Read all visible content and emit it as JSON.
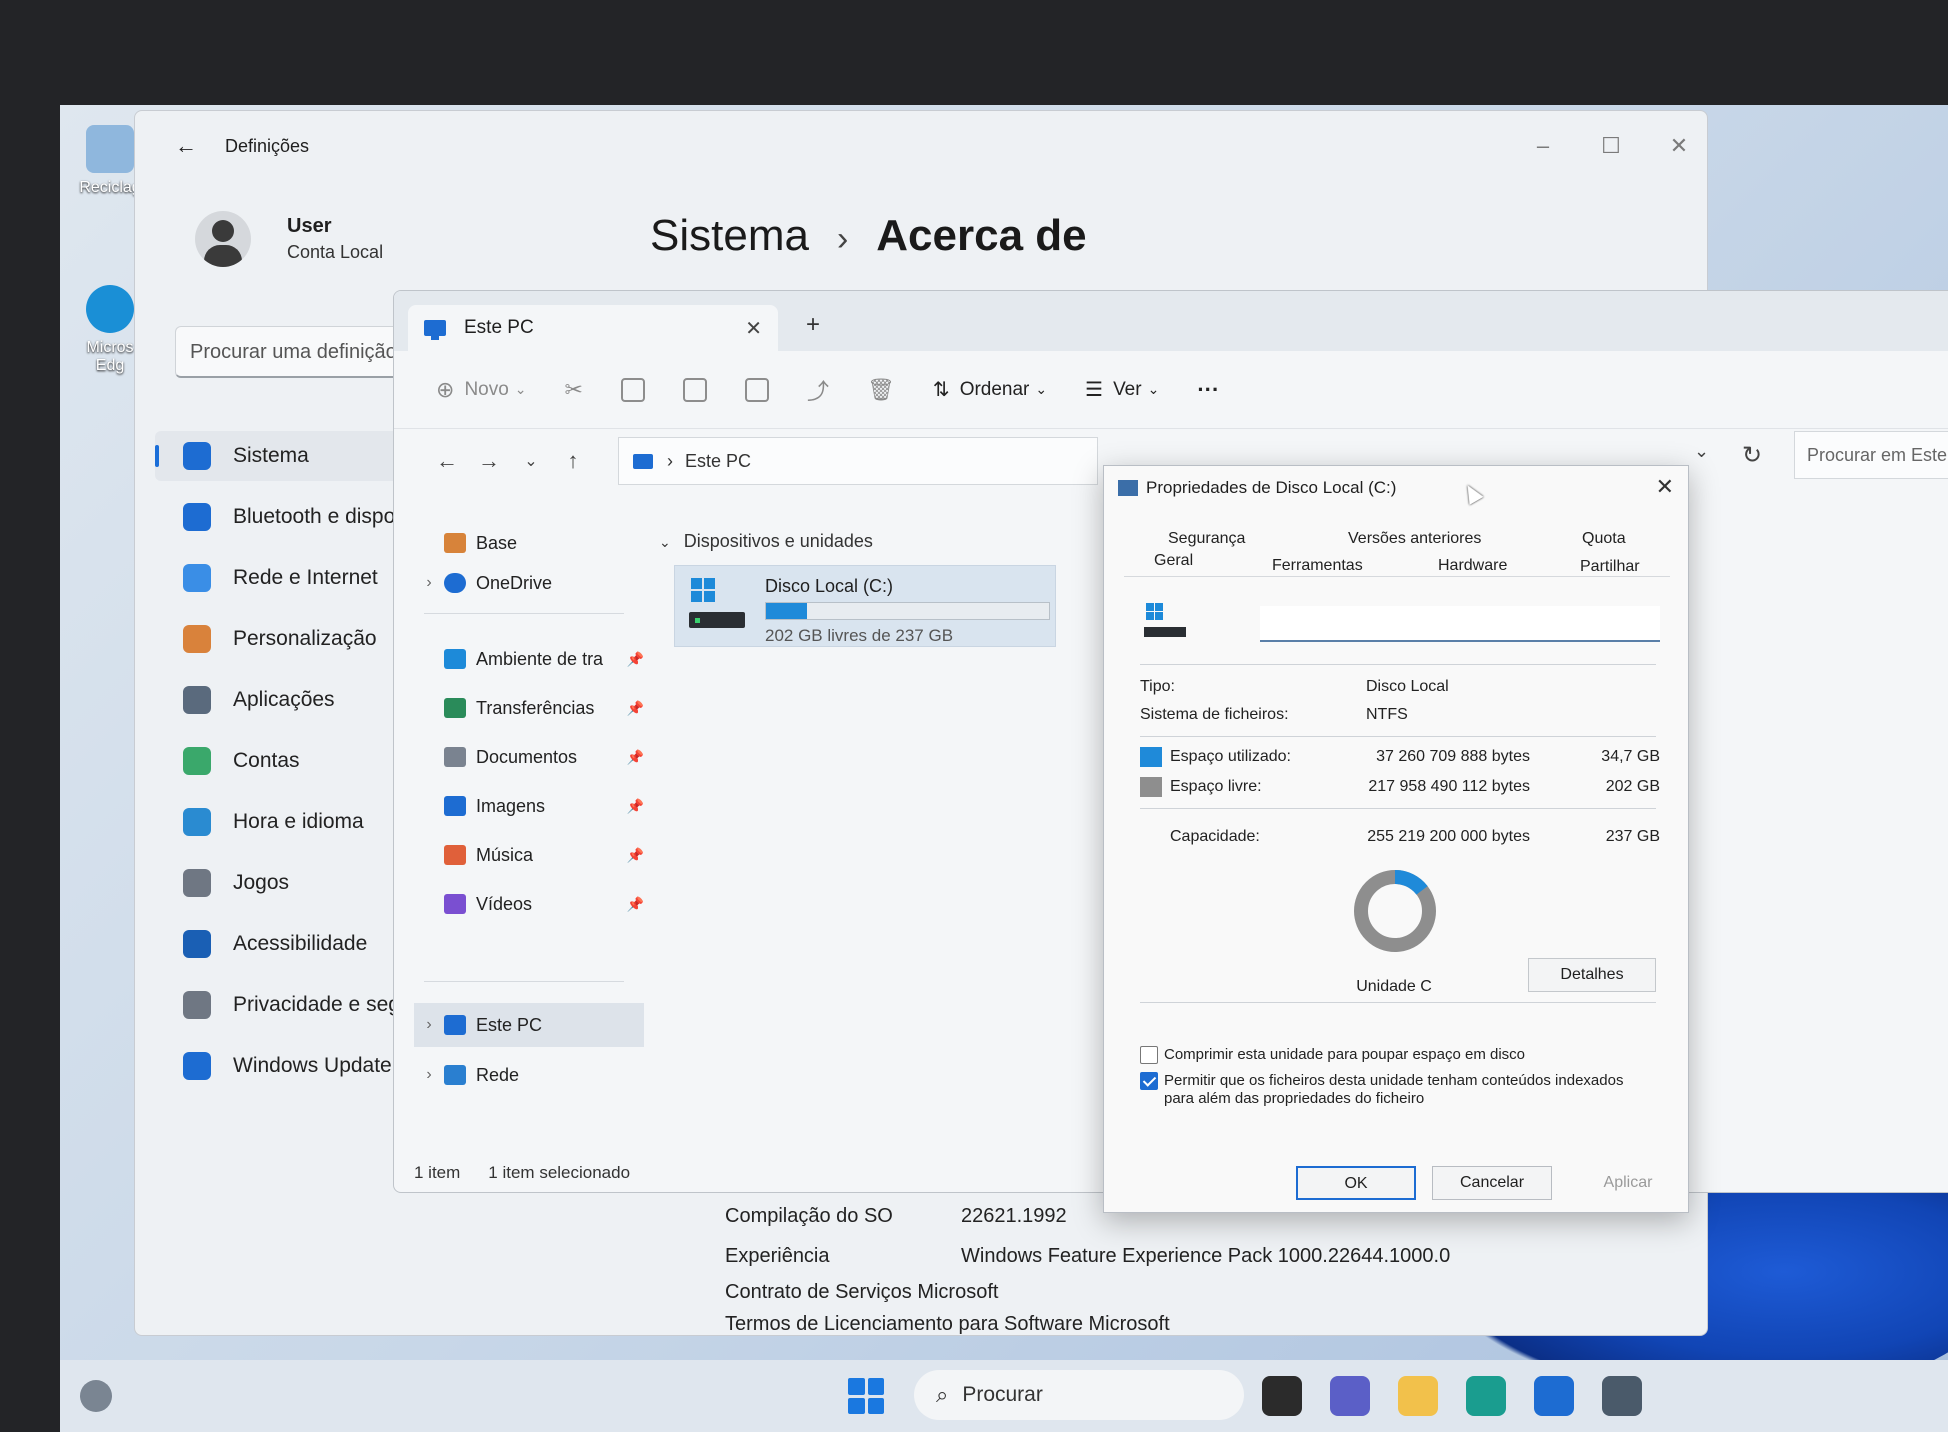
{
  "desktop": {
    "icons": [
      {
        "label": "Reciclag",
        "icon": "recycle-bin-icon"
      },
      {
        "label": "Micros Edg",
        "icon": "edge-icon"
      }
    ]
  },
  "settings": {
    "title": "Definições",
    "user": {
      "name": "User",
      "account": "Conta Local"
    },
    "search_placeholder": "Procurar uma definição",
    "breadcrumb": {
      "parent": "Sistema",
      "separator": "›",
      "current": "Acerca de"
    },
    "nav": [
      {
        "label": "Sistema",
        "icon": "system-icon",
        "color": "#1d6cd2"
      },
      {
        "label": "Bluetooth e dispo",
        "icon": "bluetooth-icon",
        "color": "#1d6cd2"
      },
      {
        "label": "Rede e Internet",
        "icon": "wifi-icon",
        "color": "#3a8ee6"
      },
      {
        "label": "Personalização",
        "icon": "brush-icon",
        "color": "#d9823b"
      },
      {
        "label": "Aplicações",
        "icon": "apps-icon",
        "color": "#5a6a7d"
      },
      {
        "label": "Contas",
        "icon": "account-icon",
        "color": "#3aa86b"
      },
      {
        "label": "Hora e idioma",
        "icon": "globe-clock-icon",
        "color": "#2a8bd1"
      },
      {
        "label": "Jogos",
        "icon": "gamepad-icon",
        "color": "#6f7783"
      },
      {
        "label": "Acessibilidade",
        "icon": "accessibility-icon",
        "color": "#1a5fb4"
      },
      {
        "label": "Privacidade e seg",
        "icon": "shield-icon",
        "color": "#6f7783"
      },
      {
        "label": "Windows Update",
        "icon": "update-icon",
        "color": "#1d6cd2"
      }
    ],
    "about": {
      "rows": [
        {
          "key": "Compilação do SO",
          "value": "22621.1992"
        },
        {
          "key": "Experiência",
          "value": "Windows Feature Experience Pack 1000.22644.1000.0"
        }
      ],
      "links": [
        "Contrato de Serviços Microsoft",
        "Termos de Licenciamento para Software Microsoft"
      ]
    }
  },
  "explorer": {
    "tab_title": "Este PC",
    "toolbar": {
      "new": "Novo",
      "sort": "Ordenar",
      "view": "Ver",
      "more": "···"
    },
    "address": "Este PC",
    "search_placeholder": "Procurar em Este",
    "nav": {
      "home": "Base",
      "onedrive": "OneDrive",
      "quick": [
        {
          "label": "Ambiente de tra",
          "icon": "desktop-folder-icon",
          "color": "#1d8ad9"
        },
        {
          "label": "Transferências",
          "icon": "download-icon",
          "color": "#2a8b5a"
        },
        {
          "label": "Documentos",
          "icon": "documents-icon",
          "color": "#7a8390"
        },
        {
          "label": "Imagens",
          "icon": "pictures-icon",
          "color": "#1d6cd2"
        },
        {
          "label": "Música",
          "icon": "music-icon",
          "color": "#e0603a"
        },
        {
          "label": "Vídeos",
          "icon": "videos-icon",
          "color": "#7a4fd1"
        }
      ],
      "this_pc": "Este PC",
      "network": "Rede"
    },
    "group_header": "Dispositivos e unidades",
    "drive": {
      "name": "Disco Local (C:)",
      "free_text": "202 GB livres de 237 GB",
      "used_fraction": 0.146
    },
    "status": {
      "count": "1 item",
      "selected": "1 item selecionado"
    }
  },
  "properties": {
    "title": "Propriedades de Disco Local (C:)",
    "tabs_row1": [
      "Segurança",
      "Versões anteriores",
      "Quota"
    ],
    "tabs_row2": [
      "Geral",
      "Ferramentas",
      "Hardware",
      "Partilhar"
    ],
    "name_value": "",
    "type_label": "Tipo:",
    "type_value": "Disco Local",
    "fs_label": "Sistema de ficheiros:",
    "fs_value": "NTFS",
    "used": {
      "label": "Espaço utilizado:",
      "bytes": "37 260 709 888 bytes",
      "gb": "34,7 GB",
      "color": "#1f8ad9"
    },
    "free": {
      "label": "Espaço livre:",
      "bytes": "217 958 490 112 bytes",
      "gb": "202 GB",
      "color": "#8e8e8e"
    },
    "capacity": {
      "label": "Capacidade:",
      "bytes": "255 219 200 000 bytes",
      "gb": "237 GB"
    },
    "used_fraction": 0.146,
    "drive_label": "Unidade C",
    "details_button": "Detalhes",
    "compress_label": "Comprimir esta unidade para poupar espaço em disco",
    "compress_checked": false,
    "index_label": "Permitir que os ficheiros desta unidade tenham conteúdos indexados para além das propriedades do ficheiro",
    "index_checked": true,
    "buttons": {
      "ok": "OK",
      "cancel": "Cancelar",
      "apply": "Aplicar"
    }
  },
  "taskbar": {
    "search_placeholder": "Procurar",
    "apps": [
      {
        "icon": "task-view-icon",
        "color": "#2b2b2b"
      },
      {
        "icon": "chat-icon",
        "color": "#5b5fc7"
      },
      {
        "icon": "file-explorer-icon",
        "color": "#f2c14b"
      },
      {
        "icon": "edge-icon",
        "color": "#1a9d8f"
      },
      {
        "icon": "store-icon",
        "color": "#1d6cd2"
      },
      {
        "icon": "settings-gear-icon",
        "color": "#4a5a6a"
      }
    ]
  }
}
